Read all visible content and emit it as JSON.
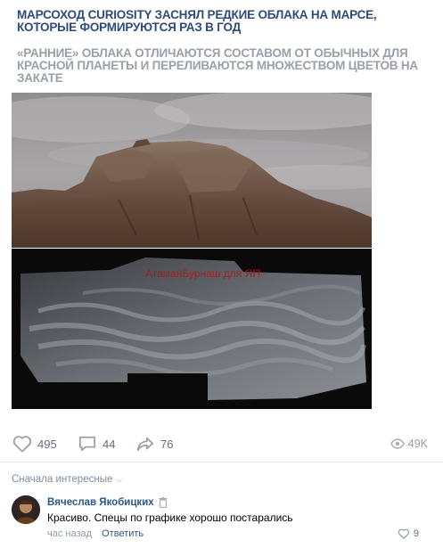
{
  "post": {
    "headline": "МАРСОХОД CURIOSITY ЗАСНЯЛ РЕДКИЕ ОБЛАКА НА МАРСЕ, КОТОРЫЕ ФОРМИРУЮТСЯ РАЗ В ГОД",
    "subheadline": "«РАННИЕ» ОБЛАКА ОТЛИЧАЮТСЯ СОСТАВОМ ОТ ОБЫЧНЫХ ДЛЯ КРАСНОЙ ПЛАНЕТЫ И ПЕРЕЛИВАЮТСЯ МНОЖЕСТВОМ ЦВЕТОВ НА ЗАКАТЕ",
    "watermark": "АтаманБурнаш для ЯП"
  },
  "actions": {
    "likes": "495",
    "comments": "44",
    "shares": "76",
    "views": "49K"
  },
  "comments_section": {
    "sort_label": "Сначала интересные",
    "items": [
      {
        "author": "Вячеслав Якобицких",
        "text": "Красиво. Спецы по графике хорошо постарались",
        "time": "час назад",
        "reply_label": "Ответить",
        "likes": "9"
      }
    ]
  },
  "colors": {
    "headline": "#2f4c78",
    "subheadline": "#9aa0a8",
    "link": "#2a5885",
    "meta": "#939cab"
  },
  "icons": [
    "heart-icon",
    "comment-icon",
    "share-icon",
    "eye-icon",
    "trash-icon",
    "chevron-down-icon"
  ]
}
